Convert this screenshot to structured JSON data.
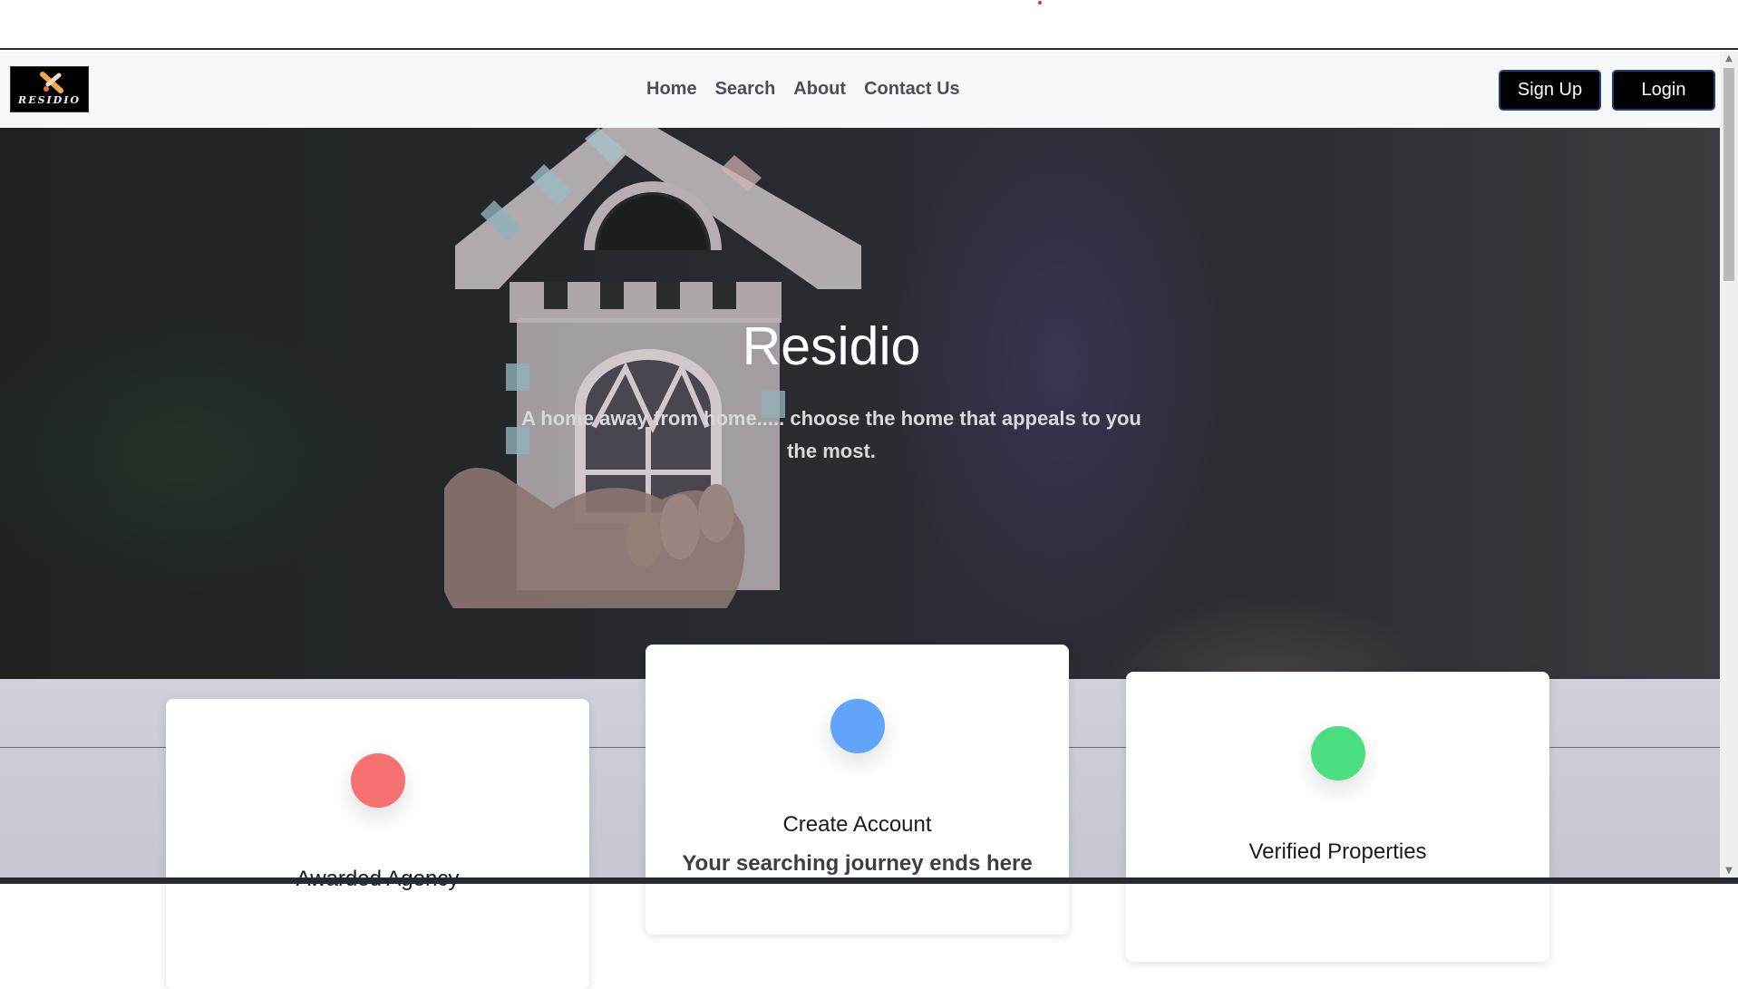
{
  "brand": {
    "logo_text": "RESIDIO"
  },
  "nav": {
    "links": [
      "Home",
      "Search",
      "About",
      "Contact Us"
    ],
    "signup_label": "Sign Up",
    "login_label": "Login"
  },
  "hero": {
    "title": "Residio",
    "subtitle": "A home away from home..... choose the home that appeals to you the most."
  },
  "cards": [
    {
      "title": "Awarded Agency",
      "subtitle": "",
      "dot_color": "#f87171"
    },
    {
      "title": "Create Account",
      "subtitle": "Your searching journey ends here",
      "dot_color": "#60a5fa"
    },
    {
      "title": "Verified Properties",
      "subtitle": "",
      "dot_color": "#4ade80"
    }
  ],
  "colors": {
    "nav_bg": "#f7f8fa",
    "button_bg": "#000000",
    "button_border": "#1f3e7a"
  }
}
